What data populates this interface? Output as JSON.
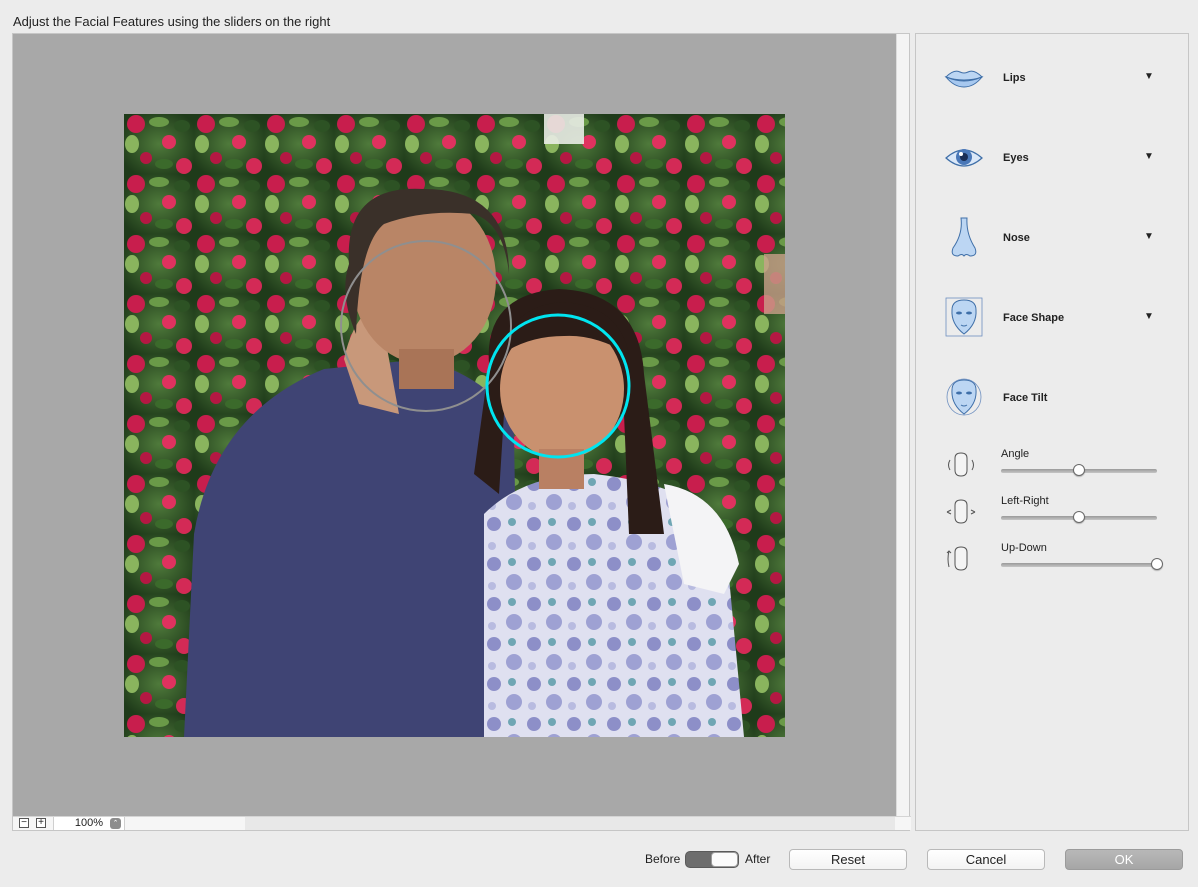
{
  "dialog": {
    "instructions": "Adjust the Facial Features using the sliders on the right"
  },
  "preview": {
    "zoom_out_glyph": "−",
    "zoom_in_glyph": "+",
    "zoom_value": "100%",
    "stepper_glyph": "⌃",
    "selection_colors": {
      "inactive": "#8f8f8f",
      "active": "#00e5f0"
    }
  },
  "features": {
    "lips": {
      "label": "Lips",
      "arrow": "▼",
      "icon": "lips-icon"
    },
    "eyes": {
      "label": "Eyes",
      "arrow": "▼",
      "icon": "eye-icon"
    },
    "nose": {
      "label": "Nose",
      "arrow": "▼",
      "icon": "nose-icon"
    },
    "face_shape": {
      "label": "Face Shape",
      "arrow": "▼",
      "icon": "face-shape-icon"
    },
    "face_tilt": {
      "label": "Face Tilt",
      "icon": "face-tilt-icon"
    }
  },
  "sliders": {
    "angle": {
      "label": "Angle",
      "value": 0.5
    },
    "left_right": {
      "label": "Left-Right",
      "value": 0.5
    },
    "up_down": {
      "label": "Up-Down",
      "value": 1.0
    }
  },
  "footer": {
    "before_label": "Before",
    "after_label": "After",
    "toggle_state": "after",
    "reset_label": "Reset",
    "cancel_label": "Cancel",
    "ok_label": "OK"
  }
}
